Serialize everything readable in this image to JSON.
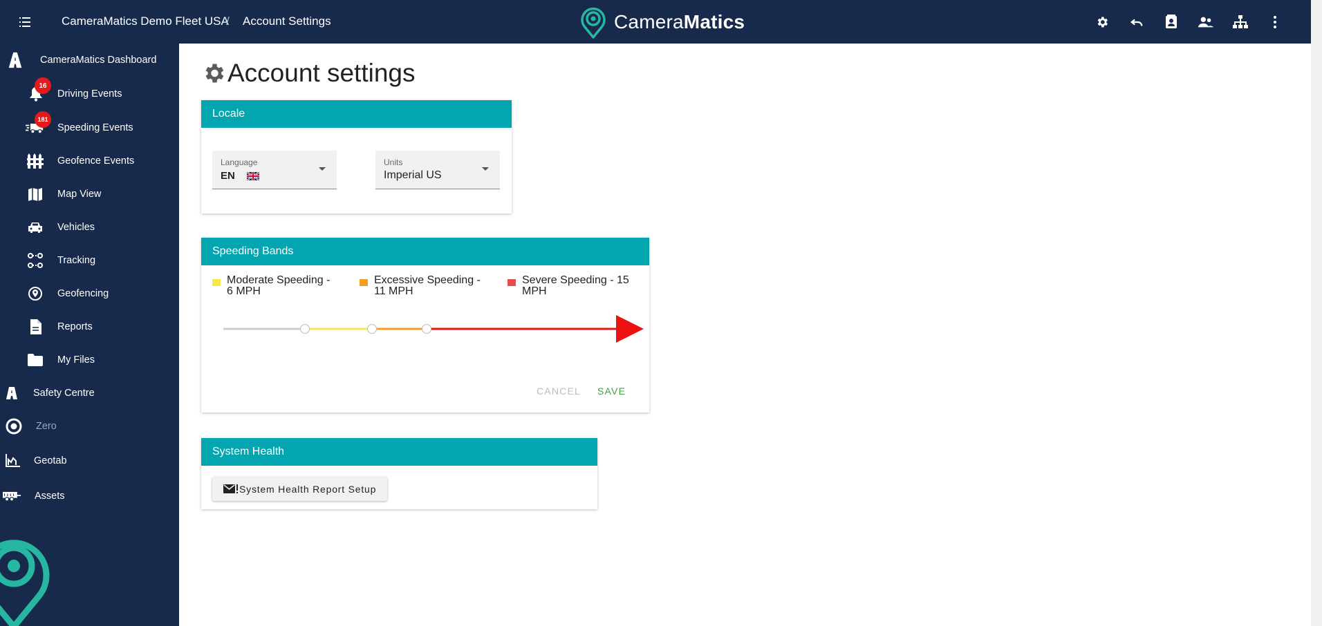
{
  "header": {
    "fleet_name": "CameraMatics Demo Fleet USA",
    "separator": "/",
    "page_crumb": "Account Settings",
    "brand_regular": "Camera",
    "brand_bold": "Matics"
  },
  "sidebar": {
    "items": [
      {
        "label": "CameraMatics Dashboard",
        "icon": "road-icon"
      },
      {
        "label": "Driving Events",
        "icon": "bell-icon",
        "badge": "16"
      },
      {
        "label": "Speeding Events",
        "icon": "speeding-truck-icon",
        "badge": "181"
      },
      {
        "label": "Geofence Events",
        "icon": "fence-icon"
      },
      {
        "label": "Map View",
        "icon": "map-icon"
      },
      {
        "label": "Vehicles",
        "icon": "car-icon"
      },
      {
        "label": "Tracking",
        "icon": "route-icon"
      },
      {
        "label": "Geofencing",
        "icon": "location-pin-icon"
      },
      {
        "label": "Reports",
        "icon": "document-icon"
      },
      {
        "label": "My Files",
        "icon": "folder-icon"
      },
      {
        "label": "Safety Centre",
        "icon": "road-icon"
      },
      {
        "label": "Zero",
        "icon": "target-icon"
      },
      {
        "label": "Geotab",
        "icon": "geotab-icon"
      },
      {
        "label": "Assets",
        "icon": "trailer-icon"
      }
    ]
  },
  "main": {
    "title": "Account settings",
    "locale": {
      "heading": "Locale",
      "language_label": "Language",
      "language_value": "EN",
      "units_label": "Units",
      "units_value": "Imperial US"
    },
    "speeding_bands": {
      "heading": "Speeding Bands",
      "bands": [
        {
          "label": "Moderate Speeding - 6 MPH",
          "line1": "Moderate Speeding -",
          "line2": "6 MPH",
          "color": "#f5e94a"
        },
        {
          "label": "Excessive Speeding - 11 MPH",
          "line1": "Excessive Speeding -",
          "line2": "11 MPH",
          "color": "#f2a01e"
        },
        {
          "label": "Severe Speeding - 15 MPH",
          "line1": "Severe Speeding - 15",
          "line2": "MPH",
          "color": "#ea4b4b"
        }
      ],
      "cancel_label": "CANCEL",
      "save_label": "SAVE"
    },
    "system_health": {
      "heading": "System Health",
      "button_label": "System Health Report Setup"
    }
  },
  "colors": {
    "navy": "#172a4c",
    "teal_header": "#03a6b0",
    "brand_teal": "#27b7a0",
    "badge_red": "#e31b1b",
    "save_green": "#43a047",
    "slider_red": "#ee1111"
  }
}
